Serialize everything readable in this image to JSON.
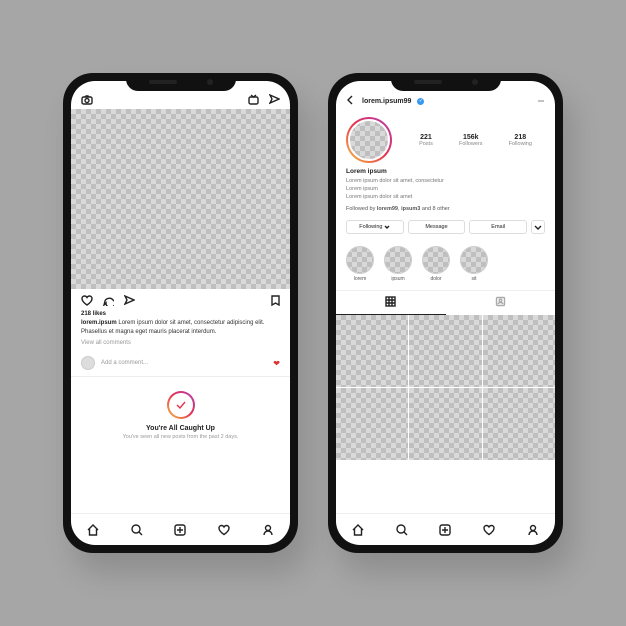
{
  "feed": {
    "likes": "218 likes",
    "user": "lorem.ipsum",
    "caption": "Lorem ipsum dolor sit amet, consectetur adipiscing elit. Phasellus et magna eget mauris placerat interdum.",
    "view_all": "View all comments",
    "add_comment": "Add a comment...",
    "caught_title": "You're All Caught Up",
    "caught_sub": "You've seen all new posts from the past 2 days."
  },
  "profile": {
    "username": "lorem.ipsum99",
    "stats": {
      "posts_num": "221",
      "posts_lbl": "Posts",
      "followers_num": "156k",
      "followers_lbl": "Followers",
      "following_num": "218",
      "following_lbl": "Following"
    },
    "bio_name": "Lorem ipsum",
    "bio_line1": "Lorem ipsum dolor sit amet, consectetur",
    "bio_line2": "Lorem ipsum",
    "bio_line3": "Lorem ipsum dolor sit amet",
    "followed_prefix": "Followed by ",
    "followed_1": "lorem99",
    "followed_2": "ipsum3",
    "followed_suffix": " and 8 other",
    "btn_following": "Following",
    "btn_message": "Message",
    "btn_email": "Email",
    "highlights": [
      "lorem",
      "ipsum",
      "dolor",
      "sit"
    ]
  }
}
